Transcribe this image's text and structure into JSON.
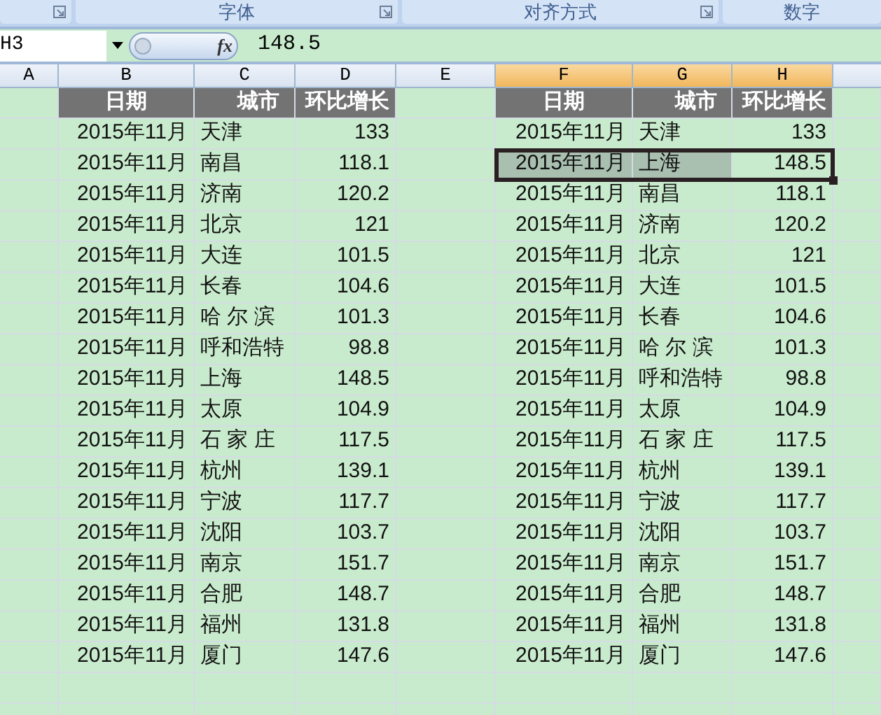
{
  "ribbon_groups": [
    {
      "label": "字体"
    },
    {
      "label": "对齐方式"
    },
    {
      "label": "数字"
    }
  ],
  "formula_bar": {
    "name_box": "H3",
    "fx": "fx",
    "value": "148.5"
  },
  "columns": [
    {
      "letter": "A",
      "highlighted": false
    },
    {
      "letter": "B",
      "highlighted": false
    },
    {
      "letter": "C",
      "highlighted": false
    },
    {
      "letter": "D",
      "highlighted": false
    },
    {
      "letter": "E",
      "highlighted": false
    },
    {
      "letter": "F",
      "highlighted": true
    },
    {
      "letter": "G",
      "highlighted": true
    },
    {
      "letter": "H",
      "highlighted": true
    }
  ],
  "left_table": {
    "headers": [
      "日期",
      "城市",
      "环比增长"
    ],
    "rows": [
      {
        "date": "2015年11月",
        "city": "天津",
        "growth": "133"
      },
      {
        "date": "2015年11月",
        "city": "南昌",
        "growth": "118.1"
      },
      {
        "date": "2015年11月",
        "city": "济南",
        "growth": "120.2"
      },
      {
        "date": "2015年11月",
        "city": "北京",
        "growth": "121"
      },
      {
        "date": "2015年11月",
        "city": "大连",
        "growth": "101.5"
      },
      {
        "date": "2015年11月",
        "city": "长春",
        "growth": "104.6"
      },
      {
        "date": "2015年11月",
        "city": "哈 尔 滨",
        "growth": "101.3"
      },
      {
        "date": "2015年11月",
        "city": "呼和浩特",
        "growth": "98.8"
      },
      {
        "date": "2015年11月",
        "city": "上海",
        "growth": "148.5"
      },
      {
        "date": "2015年11月",
        "city": "太原",
        "growth": "104.9"
      },
      {
        "date": "2015年11月",
        "city": "石 家 庄",
        "growth": "117.5"
      },
      {
        "date": "2015年11月",
        "city": "杭州",
        "growth": "139.1"
      },
      {
        "date": "2015年11月",
        "city": "宁波",
        "growth": "117.7"
      },
      {
        "date": "2015年11月",
        "city": "沈阳",
        "growth": "103.7"
      },
      {
        "date": "2015年11月",
        "city": "南京",
        "growth": "151.7"
      },
      {
        "date": "2015年11月",
        "city": "合肥",
        "growth": "148.7"
      },
      {
        "date": "2015年11月",
        "city": "福州",
        "growth": "131.8"
      },
      {
        "date": "2015年11月",
        "city": "厦门",
        "growth": "147.6"
      }
    ]
  },
  "right_table": {
    "headers": [
      "日期",
      "城市",
      "环比增长"
    ],
    "rows": [
      {
        "date": "2015年11月",
        "city": "天津",
        "growth": "133",
        "selected": false
      },
      {
        "date": "2015年11月",
        "city": "上海",
        "growth": "148.5",
        "selected": true
      },
      {
        "date": "2015年11月",
        "city": "南昌",
        "growth": "118.1",
        "selected": false
      },
      {
        "date": "2015年11月",
        "city": "济南",
        "growth": "120.2",
        "selected": false
      },
      {
        "date": "2015年11月",
        "city": "北京",
        "growth": "121",
        "selected": false
      },
      {
        "date": "2015年11月",
        "city": "大连",
        "growth": "101.5",
        "selected": false
      },
      {
        "date": "2015年11月",
        "city": "长春",
        "growth": "104.6",
        "selected": false
      },
      {
        "date": "2015年11月",
        "city": "哈 尔 滨",
        "growth": "101.3",
        "selected": false
      },
      {
        "date": "2015年11月",
        "city": "呼和浩特",
        "growth": "98.8",
        "selected": false
      },
      {
        "date": "2015年11月",
        "city": "太原",
        "growth": "104.9",
        "selected": false
      },
      {
        "date": "2015年11月",
        "city": "石 家 庄",
        "growth": "117.5",
        "selected": false
      },
      {
        "date": "2015年11月",
        "city": "杭州",
        "growth": "139.1",
        "selected": false
      },
      {
        "date": "2015年11月",
        "city": "宁波",
        "growth": "117.7",
        "selected": false
      },
      {
        "date": "2015年11月",
        "city": "沈阳",
        "growth": "103.7",
        "selected": false
      },
      {
        "date": "2015年11月",
        "city": "南京",
        "growth": "151.7",
        "selected": false
      },
      {
        "date": "2015年11月",
        "city": "合肥",
        "growth": "148.7",
        "selected": false
      },
      {
        "date": "2015年11月",
        "city": "福州",
        "growth": "131.8",
        "selected": false
      },
      {
        "date": "2015年11月",
        "city": "厦门",
        "growth": "147.6",
        "selected": false
      }
    ]
  }
}
